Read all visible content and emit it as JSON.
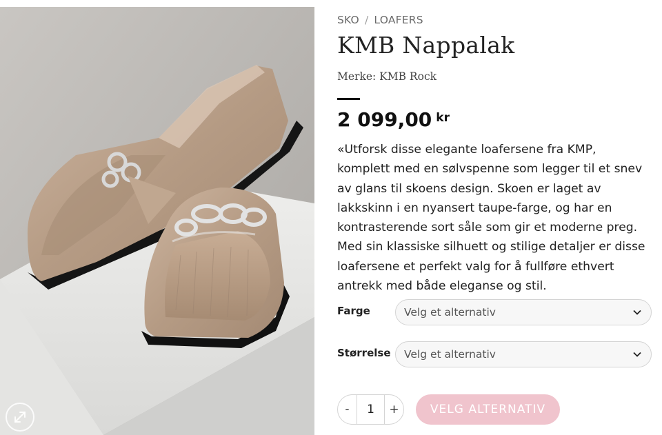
{
  "breadcrumb": {
    "items": [
      "SKO",
      "LOAFERS"
    ],
    "separator": "/"
  },
  "product": {
    "title": "KMB Nappalak",
    "brand": "Merke: KMB Rock",
    "price": "2 099,00",
    "currency": "kr",
    "description": "«Utforsk disse elegante loafersene fra KMP, komplett med en sølvspenne som legger til et snev av glans til skoens design. Skoen er laget av lakkskinn i en nyansert taupe-farge, og har en kontrasterende sort såle som gir et moderne preg. Med sin klassiske silhuett og stilige detaljer er disse loafersene et perfekt valg for å fullføre ethvert antrekk med både eleganse og stil."
  },
  "options": {
    "color": {
      "label": "Farge",
      "value": "Velg et alternativ"
    },
    "size": {
      "label": "Størrelse",
      "value": "Velg et alternativ"
    }
  },
  "cart": {
    "minus": "-",
    "quantity": "1",
    "plus": "+",
    "button_label": "VELG ALTERNATIV"
  },
  "colors": {
    "button": "#f0c4cd",
    "shoe": "#b9a08a",
    "sole": "#111111"
  },
  "icons": {
    "zoom": "expand-icon",
    "dropdown": "chevron-down-icon"
  }
}
